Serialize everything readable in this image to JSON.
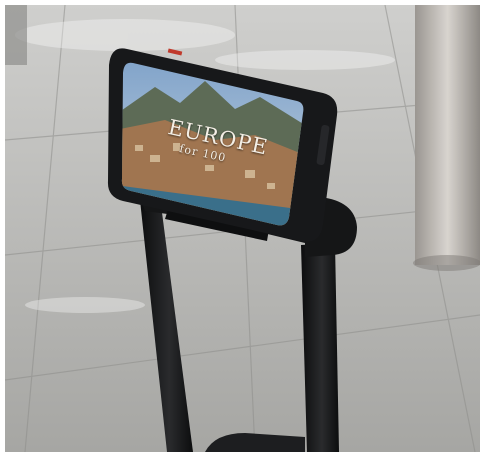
{
  "screen": {
    "title": "EUROPE",
    "subtitle": "for 100"
  },
  "colors": {
    "floor_tile": "#b7b7b4",
    "pole": "#121314",
    "phone_case": "#17181a",
    "sky": "#6e8fb4",
    "coast": "#a07550",
    "sea": "#3a6f8a"
  }
}
